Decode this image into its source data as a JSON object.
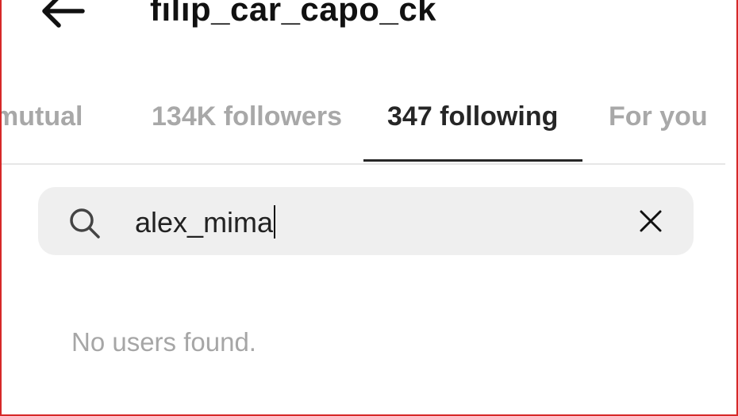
{
  "header": {
    "title": "filip_car_capo_ck",
    "back_icon": "arrow-left-icon"
  },
  "tabs": [
    {
      "label": "mutual",
      "active": false
    },
    {
      "label": "134K followers",
      "active": false
    },
    {
      "label": "347 following",
      "active": true
    },
    {
      "label": "For you",
      "active": false
    }
  ],
  "search": {
    "value": "alex_mima",
    "search_icon": "search-icon",
    "clear_icon": "close-icon"
  },
  "results": {
    "empty_message": "No users found."
  },
  "colors": {
    "border": "#d62828",
    "active_text": "#262626",
    "inactive_text": "#a8a8a8",
    "search_background": "#efefef"
  }
}
